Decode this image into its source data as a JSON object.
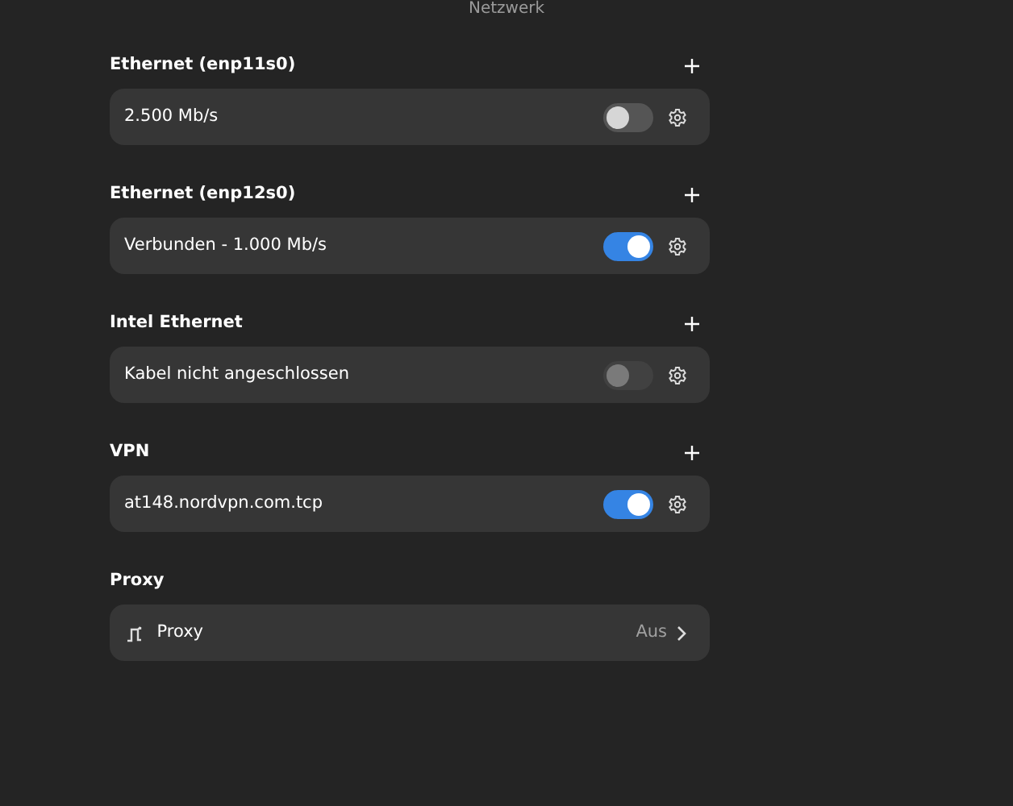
{
  "window": {
    "title": "Netzwerk"
  },
  "sections": [
    {
      "title": "Ethernet (enp11s0)",
      "kind": "device",
      "rows": [
        {
          "label": "2.500 Mb/s",
          "on": false,
          "disabled": false
        }
      ]
    },
    {
      "title": "Ethernet (enp12s0)",
      "kind": "device",
      "rows": [
        {
          "label": "Verbunden - 1.000 Mb/s",
          "on": true,
          "disabled": false
        }
      ]
    },
    {
      "title": "Intel Ethernet",
      "kind": "device",
      "rows": [
        {
          "label": "Kabel nicht angeschlossen",
          "on": false,
          "disabled": true
        }
      ]
    },
    {
      "title": "VPN",
      "kind": "device",
      "rows": [
        {
          "label": "at148.nordvpn.com.tcp",
          "on": true,
          "disabled": false
        }
      ]
    },
    {
      "title": "Proxy",
      "kind": "link",
      "rows": [
        {
          "label": "Proxy",
          "value": "Aus"
        }
      ]
    }
  ]
}
